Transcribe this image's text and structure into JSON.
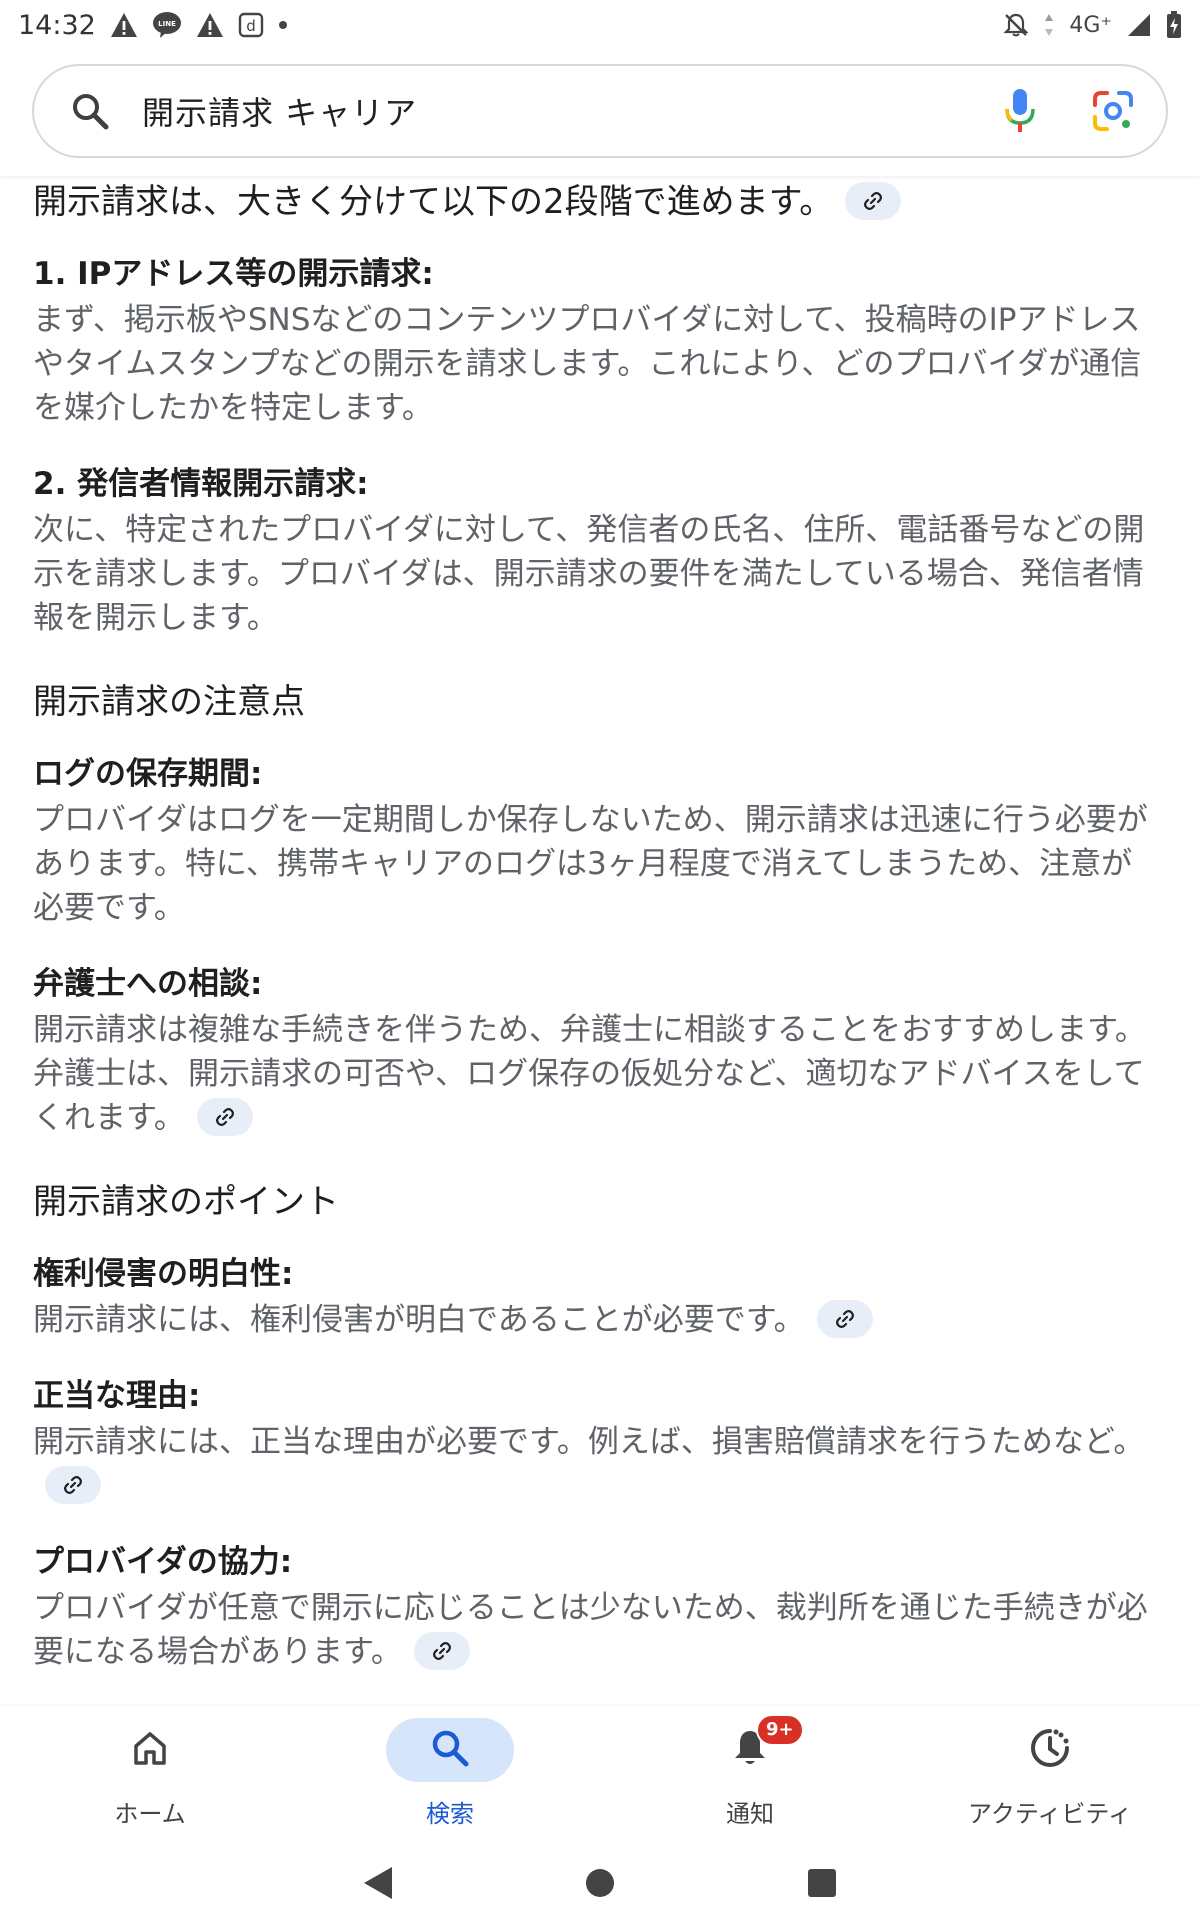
{
  "status_bar": {
    "time": "14:32",
    "network": "4G⁺",
    "icons": [
      "warning-icon",
      "line-app-icon",
      "warning-icon",
      "d-app-icon",
      "dot-icon",
      "mute-icon",
      "data-arrows-icon",
      "signal-icon",
      "battery-charging-icon"
    ]
  },
  "search": {
    "query": "開示請求 キャリア",
    "icons": [
      "search-icon",
      "mic-icon",
      "lens-icon"
    ]
  },
  "content": {
    "intro": "開示請求は、大きく分けて以下の2段階で進めます。",
    "steps": [
      {
        "title": "1. IPアドレス等の開示請求:",
        "body": "まず、掲示板やSNSなどのコンテンツプロバイダに対して、投稿時のIPアドレスやタイムスタンプなどの開示を請求します。これにより、どのプロバイダが通信を媒介したかを特定します。"
      },
      {
        "title": "2. 発信者情報開示請求:",
        "body": "次に、特定されたプロバイダに対して、発信者の氏名、住所、電話番号などの開示を請求します。プロバイダは、開示請求の要件を満たしている場合、発信者情報を開示します。"
      }
    ],
    "section1": {
      "heading": "開示請求の注意点",
      "items": [
        {
          "title": "ログの保存期間:",
          "body": "プロバイダはログを一定期間しか保存しないため、開示請求は迅速に行う必要があります。特に、携帯キャリアのログは3ヶ月程度で消えてしまうため、注意が必要です。"
        },
        {
          "title": "弁護士への相談:",
          "body": "開示請求は複雑な手続きを伴うため、弁護士に相談することをおすすめします。弁護士は、開示請求の可否や、ログ保存の仮処分など、適切なアドバイスをしてくれます。"
        }
      ]
    },
    "section2": {
      "heading": "開示請求のポイント",
      "items": [
        {
          "title": "権利侵害の明白性:",
          "body": "開示請求には、権利侵害が明白であることが必要です。"
        },
        {
          "title": "正当な理由:",
          "body": "開示請求には、正当な理由が必要です。例えば、損害賠償請求を行うためなど。"
        },
        {
          "title": "プロバイダの協力:",
          "body": "プロバイダが任意で開示に応じることは少ないため、裁判所を通じた手続きが必要になる場合があります。"
        }
      ]
    }
  },
  "bottom_nav": {
    "items": [
      {
        "label": "ホーム",
        "icon": "home-icon",
        "active": false
      },
      {
        "label": "検索",
        "icon": "search-icon",
        "active": true
      },
      {
        "label": "通知",
        "icon": "bell-icon",
        "active": false,
        "badge": "9+"
      },
      {
        "label": "アクティビティ",
        "icon": "activity-icon",
        "active": false
      }
    ]
  },
  "system_nav": [
    "back-icon",
    "home-circle-icon",
    "recents-icon"
  ],
  "colors": {
    "accent": "#1a5bd6",
    "active_pill": "#d7e5fb",
    "link_chip": "#e8eef8",
    "badge": "#d93025",
    "body_text": "#5f6368"
  }
}
